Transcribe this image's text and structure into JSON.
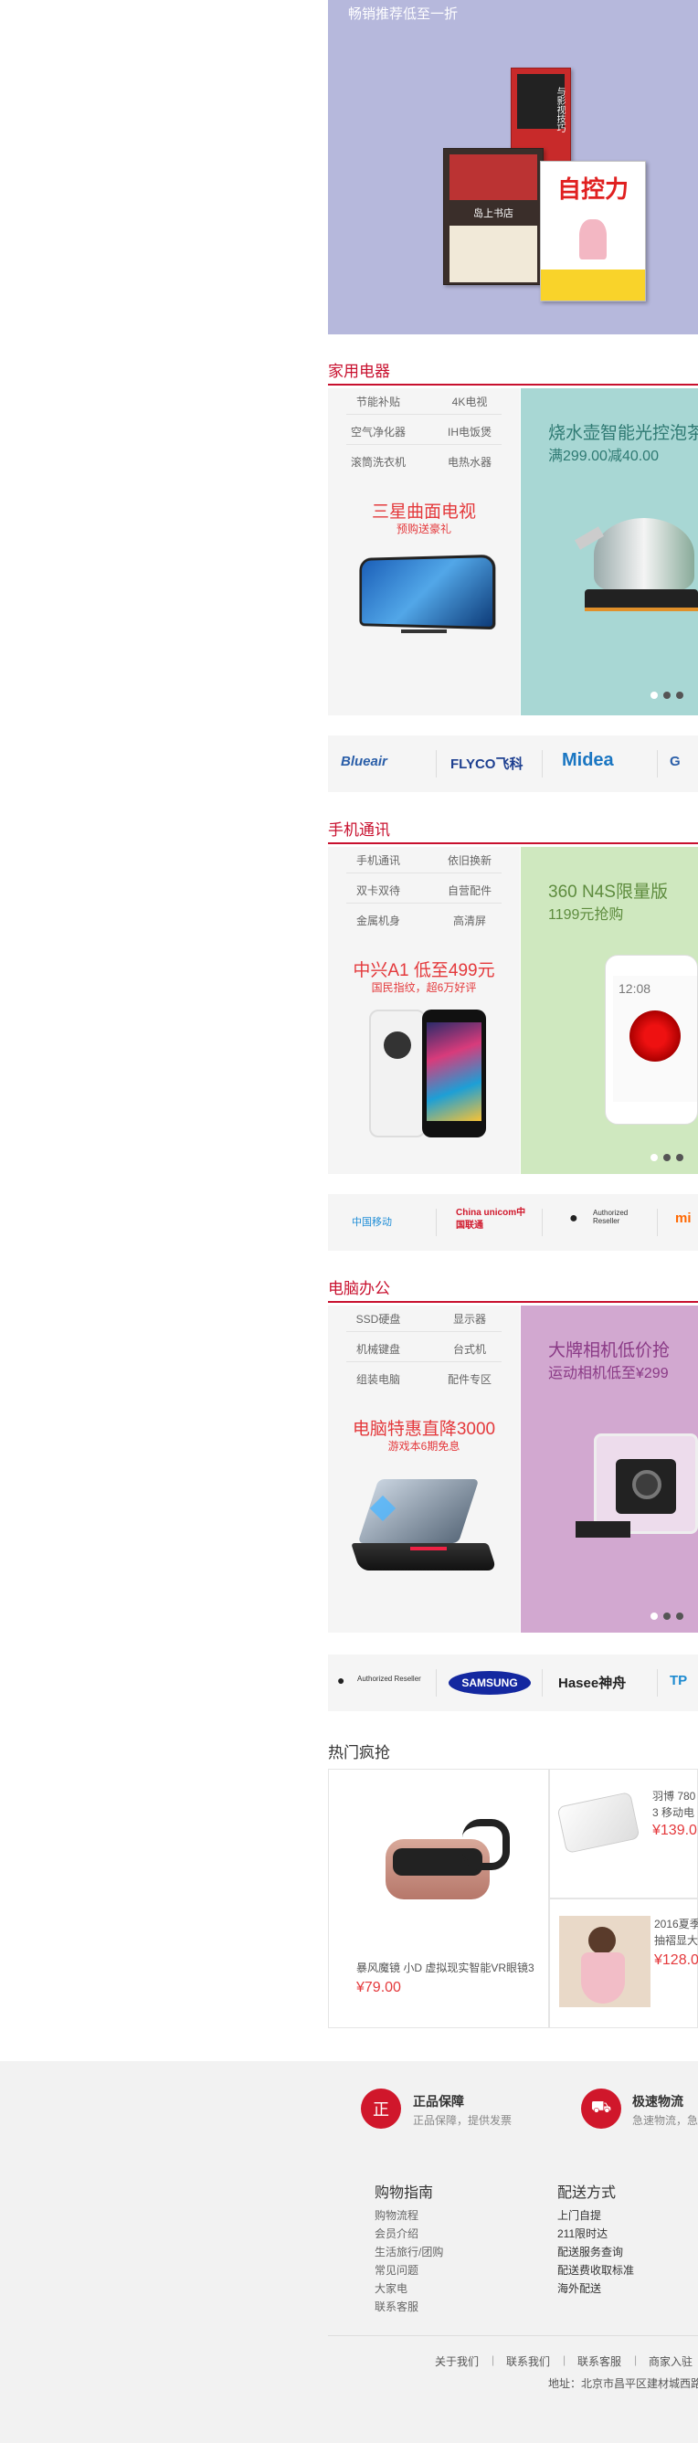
{
  "top_banner": {
    "subtitle": "畅销推荐低至一折",
    "books": [
      "自控力",
      "岛上书店",
      "与影视技巧"
    ]
  },
  "appliances": {
    "title": "家用电器",
    "links": [
      "节能补贴",
      "4K电视",
      "空气净化器",
      "IH电饭煲",
      "滚筒洗衣机",
      "电热水器"
    ],
    "promo_title": "三星曲面电视",
    "promo_sub": "预购送豪礼",
    "feature_title": "烧水壶智能光控泡茶",
    "feature_sub": "满299.00减40.00",
    "brands": [
      "Blueair",
      "FLYCO飞科",
      "Midea",
      "G"
    ]
  },
  "phones": {
    "title": "手机通讯",
    "links": [
      "手机通讯",
      "依旧换新",
      "双卡双待",
      "自营配件",
      "金属机身",
      "高清屏"
    ],
    "promo_title": "中兴A1 低至499元",
    "promo_sub": "国民指纹，超6万好评",
    "feature_title": "360 N4S限量版",
    "feature_sub": "1199元抢购",
    "phone_time": "12:08",
    "brands": [
      "中国移动",
      "China unicom中国联通",
      "Authorized Reseller",
      "mi"
    ]
  },
  "computers": {
    "title": "电脑办公",
    "links": [
      "SSD硬盘",
      "显示器",
      "机械键盘",
      "台式机",
      "组装电脑",
      "配件专区"
    ],
    "promo_title": "电脑特惠直降3000",
    "promo_sub": "游戏本6期免息",
    "feature_title": "大牌相机低价抢",
    "feature_sub": "运动相机低至¥299",
    "brands": [
      "Authorized Reseller",
      "SAMSUNG",
      "Hasee神舟",
      "TP"
    ]
  },
  "hot_sale": {
    "title": "热门疯抢",
    "items": [
      {
        "name": "暴风魔镜 小D 虚拟现实智能VR眼镜3",
        "price": "¥79.00"
      },
      {
        "name": "羽博 780\n3 移动电",
        "price": "¥139.0"
      },
      {
        "name": "2016夏季\n抽褶显大",
        "price": "¥128.0"
      }
    ]
  },
  "footer": {
    "services": [
      {
        "icon": "正",
        "title": "正品保障",
        "sub": "正品保障，提供发票"
      },
      {
        "icon": "⛟",
        "title": "极速物流",
        "sub": "急速物流，急"
      }
    ],
    "guide_title": "购物指南",
    "guide_links": [
      "购物流程",
      "会员介绍",
      "生活旅行/团购",
      "常见问题",
      "大家电",
      "联系客服"
    ],
    "delivery_title": "配送方式",
    "delivery_links": [
      "上门自提",
      "211限时达",
      "配送服务查询",
      "配送费收取标准",
      "海外配送"
    ],
    "bottom_links": [
      "关于我们",
      "联系我们",
      "联系客服",
      "商家入驻"
    ],
    "address": "地址：北京市昌平区建材城西路"
  },
  "colors": {
    "accent": "#c8102e",
    "price": "#e4393c",
    "banner": "#b6b8dc",
    "kettle_bg": "#a8d7d4",
    "phone_bg": "#cfe8bf",
    "camera_bg": "#d2a8d0"
  }
}
